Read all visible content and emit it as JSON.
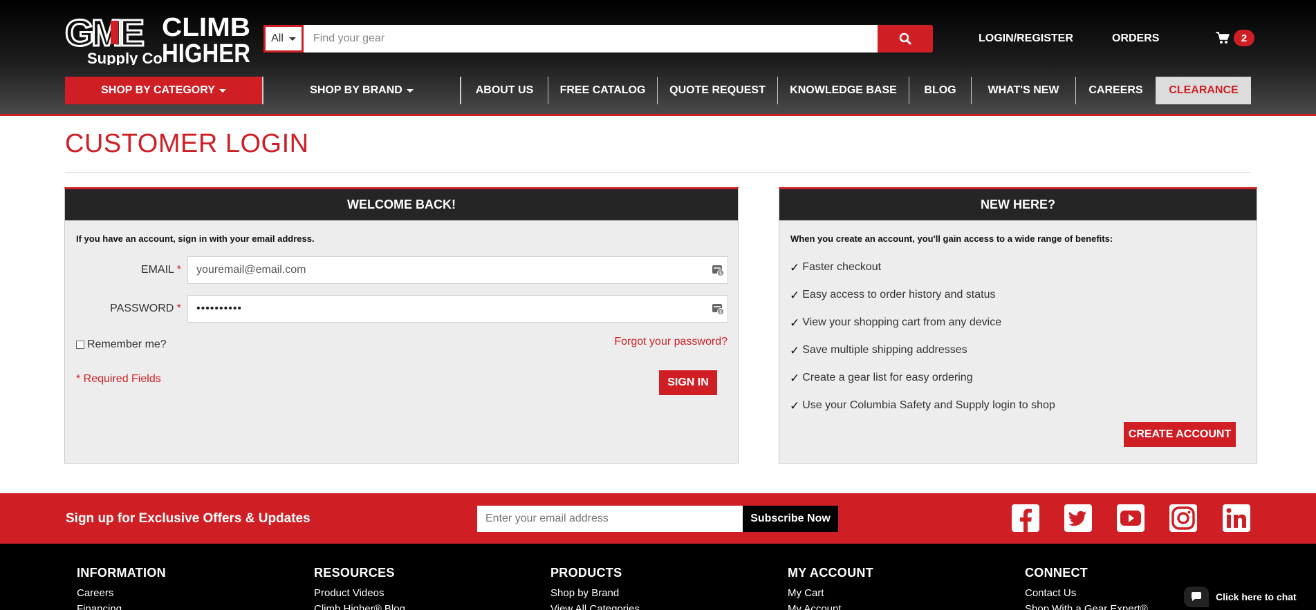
{
  "header": {
    "logo": {
      "brand_top": "GME",
      "brand_bottom": "Supply Co",
      "tagline_1": "CLIMB",
      "tagline_2": "HIGHER"
    },
    "search": {
      "category": "All",
      "placeholder": "Find your gear",
      "icon": "search-icon"
    },
    "login_label": "LOGIN/REGISTER",
    "orders_label": "ORDERS",
    "cart": {
      "icon": "cart-icon",
      "count": "2"
    }
  },
  "nav": {
    "items": [
      {
        "label": "SHOP BY CATEGORY",
        "dropdown": true
      },
      {
        "label": "SHOP BY BRAND",
        "dropdown": true
      },
      {
        "label": "ABOUT US"
      },
      {
        "label": "FREE CATALOG"
      },
      {
        "label": "QUOTE REQUEST"
      },
      {
        "label": "KNOWLEDGE BASE"
      },
      {
        "label": "BLOG"
      },
      {
        "label": "WHAT'S NEW"
      },
      {
        "label": "CAREERS"
      },
      {
        "label": "CLEARANCE"
      }
    ]
  },
  "page": {
    "title": "CUSTOMER LOGIN"
  },
  "login": {
    "heading": "WELCOME BACK!",
    "intro": "If you have an account, sign in with your email address.",
    "email_label": "EMAIL",
    "email_placeholder": "youremail@email.com",
    "password_label": "PASSWORD",
    "password_value": "••••••••••",
    "required_mark": "*",
    "remember_label": "Remember me?",
    "forgot_label": "Forgot your password?",
    "required_note": "* Required Fields",
    "signin_label": "SIGN IN"
  },
  "register": {
    "heading": "NEW HERE?",
    "intro": "When you create an account, you'll gain access to a wide range of benefits:",
    "check_mark": "✓",
    "benefits": [
      "Faster checkout",
      "Easy access to order history and status",
      "View your shopping cart from any device",
      "Save multiple shipping addresses",
      "Create a gear list for easy ordering",
      "Use your Columbia Safety and Supply login to shop"
    ],
    "create_label": "CREATE ACCOUNT"
  },
  "signup": {
    "text": "Sign up for Exclusive Offers & Updates",
    "placeholder": "Enter your email address",
    "button": "Subscribe Now",
    "social": [
      "facebook-icon",
      "twitter-icon",
      "youtube-icon",
      "instagram-icon",
      "linkedin-icon"
    ]
  },
  "footer": {
    "columns": [
      {
        "title": "INFORMATION",
        "links": [
          "Careers",
          "Financing"
        ]
      },
      {
        "title": "RESOURCES",
        "links": [
          "Product Videos",
          "Climb Higher® Blog"
        ]
      },
      {
        "title": "PRODUCTS",
        "links": [
          "Shop by Brand",
          "View All Categories"
        ]
      },
      {
        "title": "MY ACCOUNT",
        "links": [
          "My Cart",
          "My Account"
        ]
      },
      {
        "title": "CONNECT",
        "links": [
          "Contact Us",
          "Shop With a Gear Expert®"
        ]
      }
    ],
    "chat_label": "Click here to chat"
  },
  "colors": {
    "brand_red": "#cf1f24",
    "dark": "#252525",
    "panel_bg": "#ededee"
  }
}
